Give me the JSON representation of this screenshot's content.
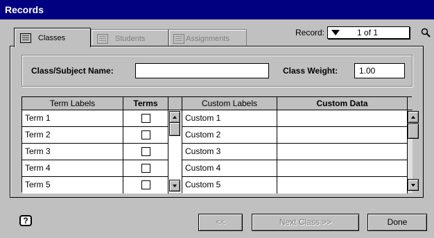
{
  "window": {
    "title": "Records"
  },
  "tabs": [
    {
      "label": "Classes",
      "icon": "class-list-icon",
      "active": true
    },
    {
      "label": "Students",
      "icon": "students-icon",
      "active": false
    },
    {
      "label": "Assignments",
      "icon": "assignments-icon",
      "active": false
    }
  ],
  "record": {
    "label": "Record:",
    "value": "1 of 1"
  },
  "form": {
    "class_name_label": "Class/Subject Name:",
    "class_name_value": "",
    "class_weight_label": "Class Weight:",
    "class_weight_value": "1.00"
  },
  "terms_table": {
    "headers": [
      "Term Labels",
      "Terms"
    ],
    "rows": [
      {
        "label": "Term 1",
        "checked": false
      },
      {
        "label": "Term 2",
        "checked": false
      },
      {
        "label": "Term 3",
        "checked": false
      },
      {
        "label": "Term 4",
        "checked": false
      },
      {
        "label": "Term 5",
        "checked": false
      }
    ]
  },
  "custom_table": {
    "headers": [
      "Custom Labels",
      "Custom Data"
    ],
    "rows": [
      {
        "label": "Custom 1",
        "data": ""
      },
      {
        "label": "Custom 2",
        "data": ""
      },
      {
        "label": "Custom 3",
        "data": ""
      },
      {
        "label": "Custom 4",
        "data": ""
      },
      {
        "label": "Custom 5",
        "data": ""
      }
    ]
  },
  "buttons": {
    "help": "?",
    "prev": "<<",
    "next": "Next Class >>",
    "done": "Done"
  },
  "colors": {
    "titlebar": "#000080",
    "face": "#c0c0c0"
  }
}
